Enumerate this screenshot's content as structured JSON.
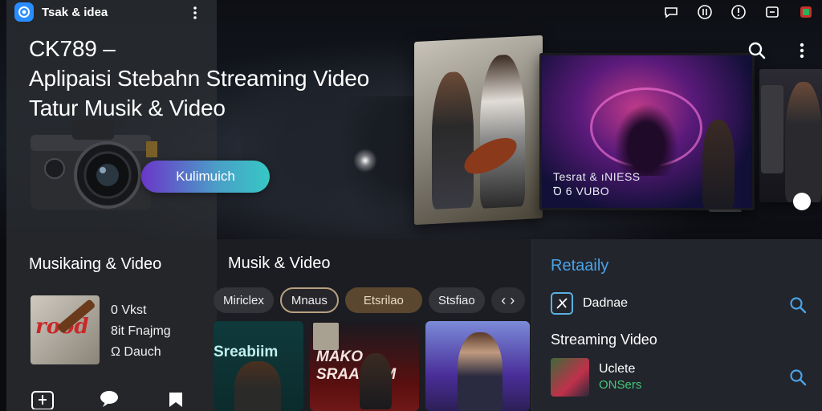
{
  "app": {
    "title": "Tsak & idea"
  },
  "hero": {
    "headline_line1": "CK789 –",
    "headline_line2": "Aplipaisi Stebahn Streaming Video",
    "headline_line3": "Tatur Musik & Video",
    "cta_label": "Kulimuich",
    "poster2_caption_line1": "Tesrat & ıNIESS",
    "poster2_caption_line2": "Ꝺ 6 VUBO"
  },
  "left_section": {
    "title": "Musikaing  & Video",
    "featured_thumb_title": "rood",
    "featured_lines": [
      "0 Vkst",
      "8it Fnajmg",
      "Ω Dauch"
    ]
  },
  "mid_section": {
    "title": "Musik & Video",
    "chips": [
      {
        "label": "Miriclex"
      },
      {
        "label": "Mnaus"
      },
      {
        "label": "Etsrilao"
      },
      {
        "label": "Stsfiao"
      },
      {
        "label": "‹ ›"
      }
    ],
    "cards": [
      {
        "title": "Sreabiim"
      },
      {
        "title": "MAKO\nSRAAKMM"
      },
      {
        "title": ""
      }
    ]
  },
  "right_section": {
    "title": "Retaaily",
    "row1_label": "Dadnae",
    "subheading": "Streaming Video",
    "item_title": "Uclete",
    "item_subtitle": "ONSers"
  },
  "colors": {
    "accent_blue": "#2a8dff",
    "cta_start": "#6a37c8",
    "cta_end": "#36c8c4",
    "right_title": "#4aa3e8",
    "green_sub": "#46c87a"
  }
}
